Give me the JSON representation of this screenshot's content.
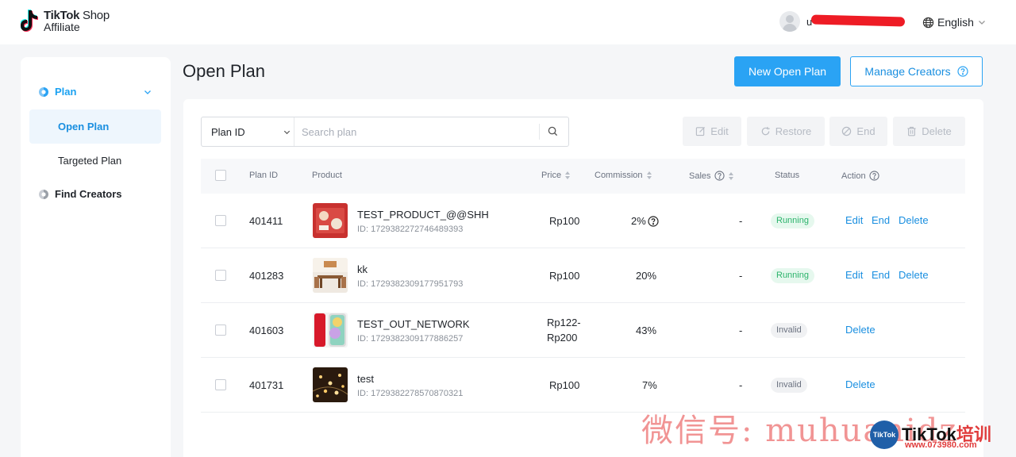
{
  "header": {
    "brand_line1": "TikTok",
    "brand_line1_b": "Shop",
    "brand_line2": "Affiliate",
    "username": "u",
    "language": "English"
  },
  "sidebar": {
    "group_label": "Plan",
    "items": [
      {
        "label": "Open Plan",
        "active": true
      },
      {
        "label": "Targeted Plan",
        "active": false
      }
    ],
    "find_creators": "Find Creators"
  },
  "main": {
    "title": "Open Plan",
    "new_button": "New Open Plan",
    "manage_button": "Manage Creators",
    "search": {
      "selected_field": "Plan ID",
      "placeholder": "Search plan"
    },
    "toolbar": {
      "edit": "Edit",
      "restore": "Restore",
      "end": "End",
      "delete": "Delete"
    },
    "columns": {
      "plan_id": "Plan ID",
      "product": "Product",
      "price": "Price",
      "commission": "Commission",
      "sales": "Sales",
      "status": "Status",
      "action": "Action"
    },
    "rows": [
      {
        "plan_id": "401411",
        "product_name": "TEST_PRODUCT_@@SHH",
        "product_id": "ID: 1729382272746489393",
        "price": "Rp100",
        "price2": "",
        "commission": "2%",
        "sales": "-",
        "status": "Running",
        "actions": [
          "Edit",
          "End",
          "Delete"
        ]
      },
      {
        "plan_id": "401283",
        "product_name": "kk",
        "product_id": "ID: 1729382309177951793",
        "price": "Rp100",
        "price2": "",
        "commission": "20%",
        "sales": "-",
        "status": "Running",
        "actions": [
          "Edit",
          "End",
          "Delete"
        ]
      },
      {
        "plan_id": "401603",
        "product_name": "TEST_OUT_NETWORK",
        "product_id": "ID: 1729382309177886257",
        "price": "Rp122-",
        "price2": "Rp200",
        "commission": "43%",
        "sales": "-",
        "status": "Invalid",
        "actions": [
          "Delete"
        ]
      },
      {
        "plan_id": "401731",
        "product_name": "test",
        "product_id": "ID: 1729382278570870321",
        "price": "Rp100",
        "price2": "",
        "commission": "7%",
        "sales": "-",
        "status": "Invalid",
        "actions": [
          "Delete"
        ]
      }
    ]
  },
  "watermark": {
    "text": "微信号: muhuanidz",
    "logo_circle": "TikTok",
    "logo_text": "TikTok",
    "logo_cn": "培训",
    "url": "www.073980.com"
  },
  "colors": {
    "accent": "#2aa3f4",
    "link": "#1a8fe0",
    "running_bg": "#e6f8ee",
    "running_text": "#2bb36b",
    "invalid_bg": "#f0f1f3"
  }
}
